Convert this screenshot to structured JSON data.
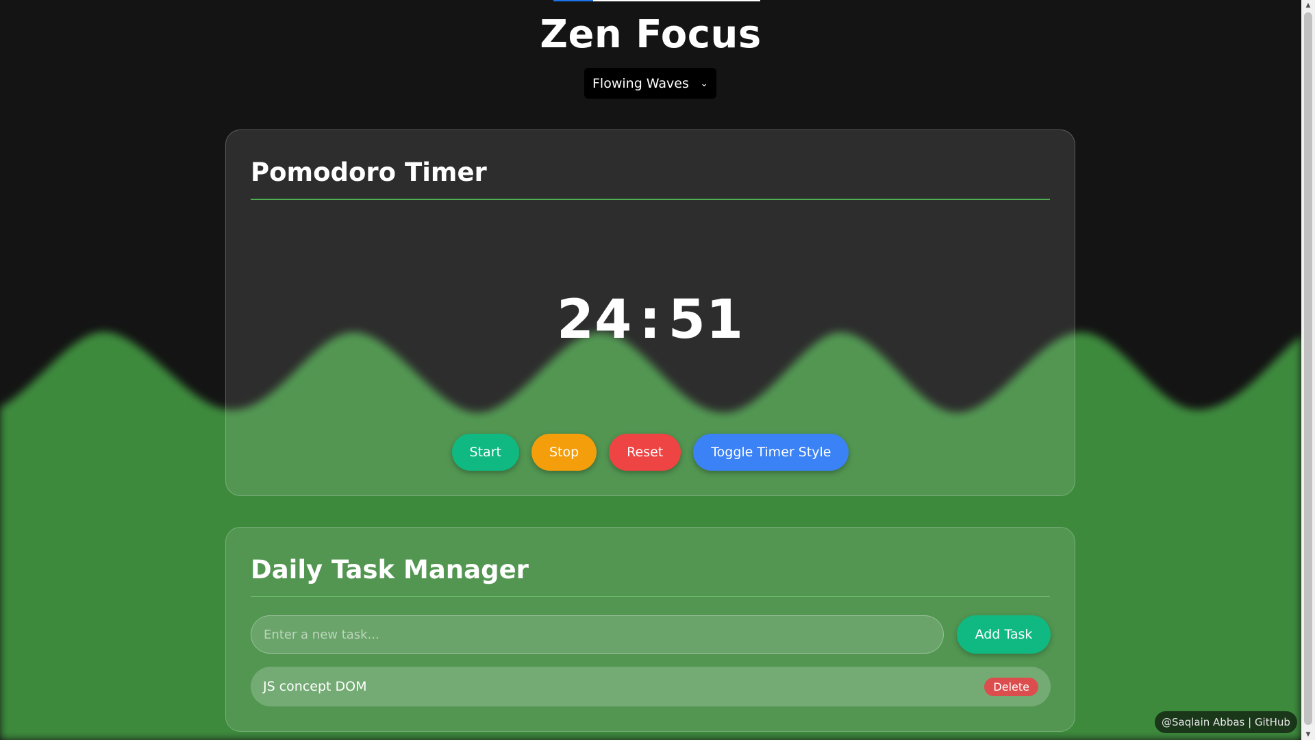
{
  "app": {
    "title": "Zen Focus",
    "theme_select": {
      "selected": "Flowing Waves"
    }
  },
  "colors": {
    "background": "#141414",
    "wave_green": "#3c8a3c",
    "start": "#10b981",
    "stop": "#f59e0b",
    "reset": "#ef4444",
    "toggle": "#3b82f6",
    "delete": "#dc4d4d"
  },
  "timer": {
    "heading": "Pomodoro Timer",
    "minutes": "24",
    "separator": ":",
    "seconds": "51",
    "buttons": {
      "start": "Start",
      "stop": "Stop",
      "reset": "Reset",
      "toggle": "Toggle Timer Style"
    }
  },
  "tasks": {
    "heading": "Daily Task Manager",
    "input_placeholder": "Enter a new task...",
    "input_value": "",
    "add_label": "Add Task",
    "items": [
      {
        "text": "JS concept DOM",
        "delete_label": "Delete"
      }
    ]
  },
  "footer": {
    "credit": "@Saqlain Abbas | GitHub"
  },
  "icons": {
    "theme_select": "chevron-down-icon"
  }
}
